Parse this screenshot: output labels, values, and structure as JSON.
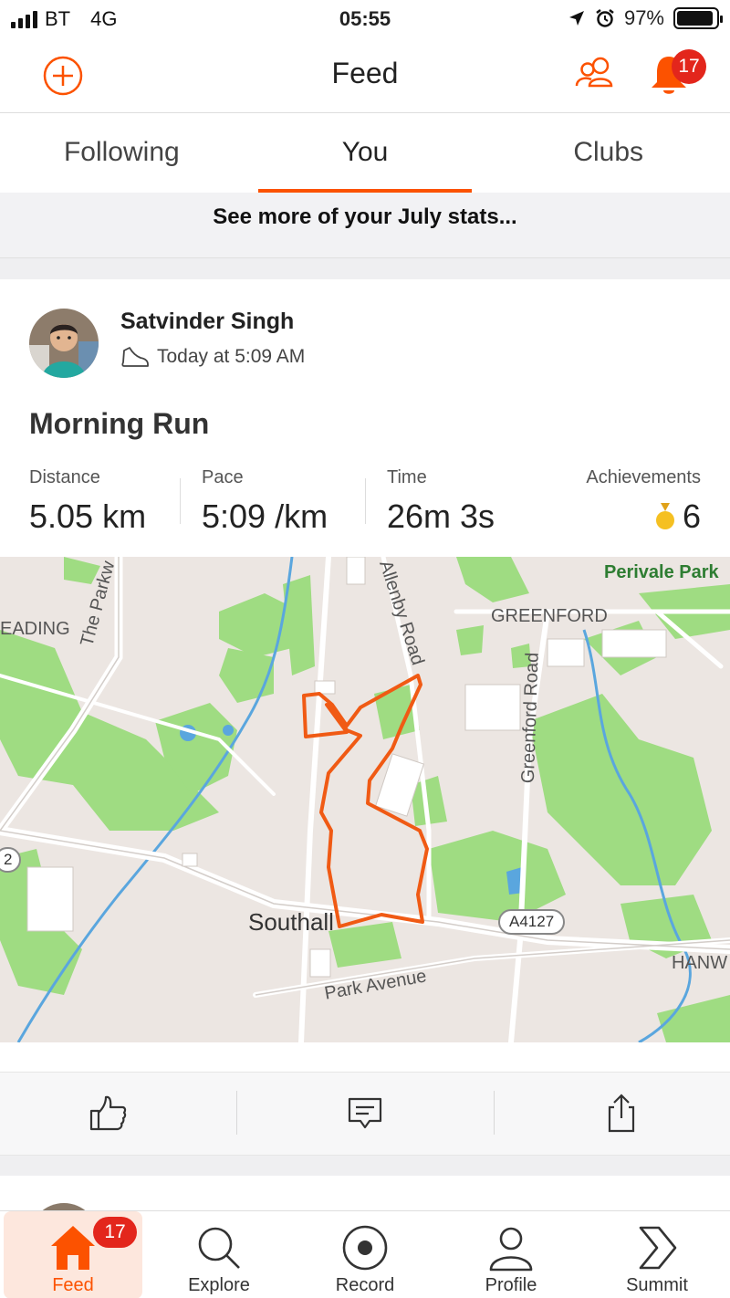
{
  "status_bar": {
    "carrier": "BT",
    "network": "4G",
    "time": "05:55",
    "battery": "97%",
    "battery_level": 0.97
  },
  "header": {
    "title": "Feed",
    "notification_count": "17"
  },
  "tabs": [
    {
      "label": "Following",
      "active": false
    },
    {
      "label": "You",
      "active": true
    },
    {
      "label": "Clubs",
      "active": false
    }
  ],
  "banner": {
    "text": "See more of your July stats..."
  },
  "activity": {
    "athlete": "Satvinder Singh",
    "timestamp": "Today at 5:09 AM",
    "title": "Morning Run",
    "stats": [
      {
        "label": "Distance",
        "value": "5.05 km"
      },
      {
        "label": "Pace",
        "value": "5:09 /km"
      },
      {
        "label": "Time",
        "value": "26m 3s"
      }
    ],
    "achievements": {
      "label": "Achievements",
      "value": "6"
    },
    "map_labels": {
      "perivale": "Perivale Park",
      "greenford": "GREENFORD",
      "reading": "EADING",
      "parkway": "The Parkw",
      "allenby": "Allenby Road",
      "greenford_road": "Greenford Road",
      "southall": "Southall",
      "a4127": "A4127",
      "park_avenue": "Park Avenue",
      "hanwell": "HANW",
      "road_2": "2"
    }
  },
  "bottom_nav": [
    {
      "label": "Feed",
      "icon": "home-icon",
      "active": true,
      "badge": "17"
    },
    {
      "label": "Explore",
      "icon": "search-icon",
      "active": false
    },
    {
      "label": "Record",
      "icon": "record-icon",
      "active": false
    },
    {
      "label": "Profile",
      "icon": "profile-icon",
      "active": false
    },
    {
      "label": "Summit",
      "icon": "summit-icon",
      "active": false
    }
  ],
  "colors": {
    "brand": "#fc5200",
    "badge": "#e3261c",
    "park": "#9fdc82",
    "route": "#f05a14"
  }
}
